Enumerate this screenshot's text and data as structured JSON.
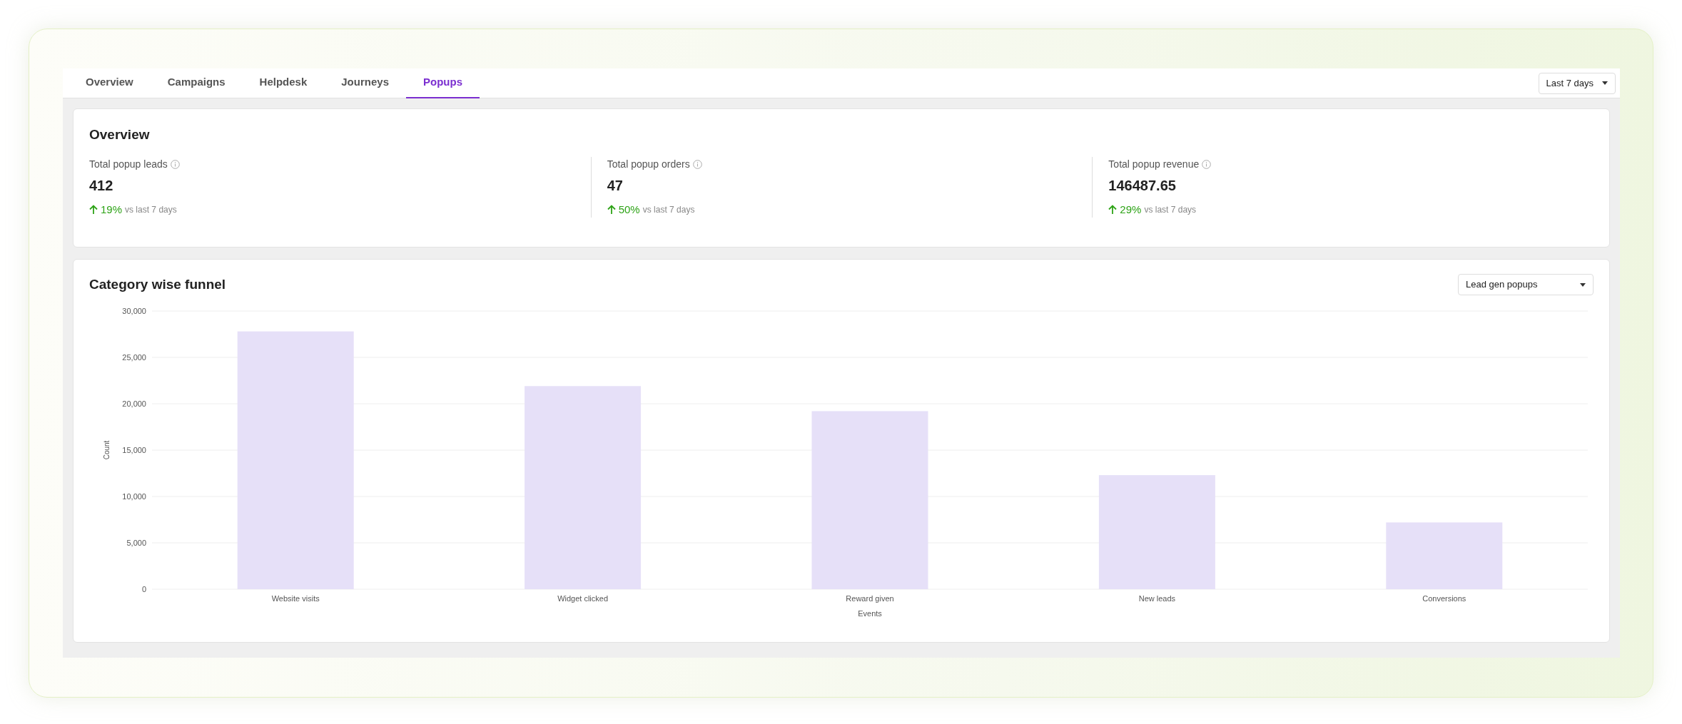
{
  "tabs": [
    {
      "label": "Overview",
      "selected": false
    },
    {
      "label": "Campaigns",
      "selected": false
    },
    {
      "label": "Helpdesk",
      "selected": false
    },
    {
      "label": "Journeys",
      "selected": false
    },
    {
      "label": "Popups",
      "selected": true
    }
  ],
  "date_range": {
    "value": "Last 7 days"
  },
  "overview": {
    "title": "Overview",
    "stats": [
      {
        "label": "Total popup leads",
        "value": "412",
        "change": "19%",
        "comparison": "vs last 7 days"
      },
      {
        "label": "Total popup orders",
        "value": "47",
        "change": "50%",
        "comparison": "vs last 7 days"
      },
      {
        "label": "Total popup revenue",
        "value": "146487.65",
        "change": "29%",
        "comparison": "vs last 7 days"
      }
    ]
  },
  "funnel": {
    "title": "Category wise funnel",
    "filter": {
      "value": "Lead gen popups"
    },
    "chart_data": {
      "type": "bar",
      "xlabel": "Events",
      "ylabel": "Count",
      "categories": [
        "Website visits",
        "Widget clicked",
        "Reward given",
        "New leads",
        "Conversions"
      ],
      "series": [
        {
          "color": "#e6e0f8",
          "values": [
            27800,
            21900,
            19200,
            12300,
            7200
          ]
        }
      ],
      "grid": true,
      "ylim": [
        0,
        30000
      ],
      "yticks": [
        {
          "value": 0,
          "label": "0"
        },
        {
          "value": 5000,
          "label": "5,000"
        },
        {
          "value": 10000,
          "label": "10,000"
        },
        {
          "value": 15000,
          "label": "15,000"
        },
        {
          "value": 20000,
          "label": "20,000"
        },
        {
          "value": 25000,
          "label": "25,000"
        },
        {
          "value": 30000,
          "label": "30,000"
        }
      ]
    }
  }
}
